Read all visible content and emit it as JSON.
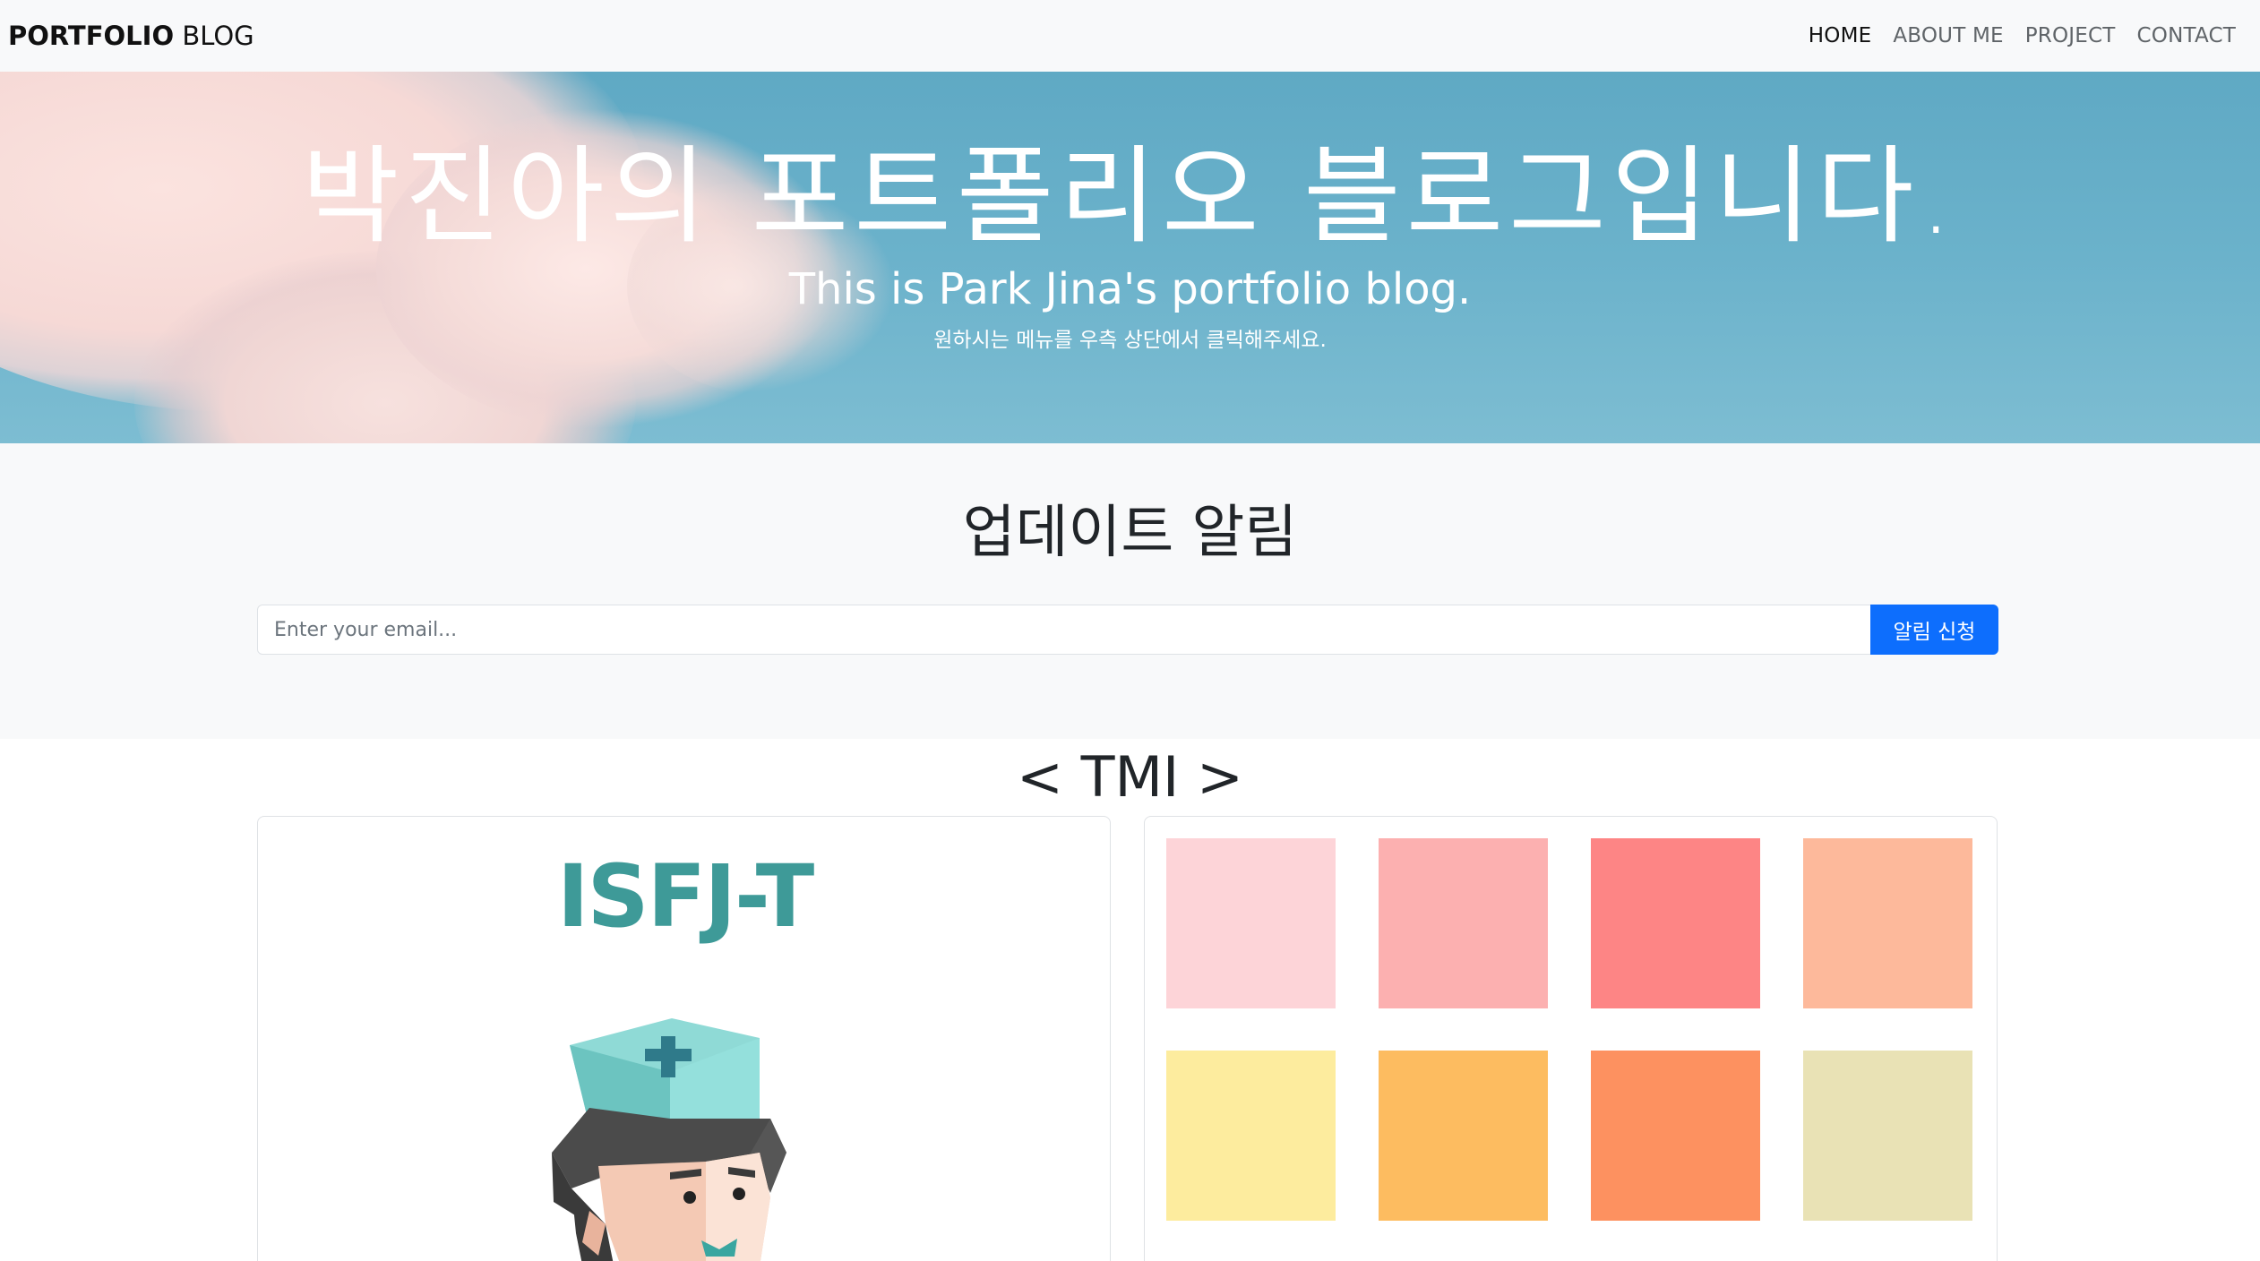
{
  "navbar": {
    "brand_bold": "PORTFOLIO",
    "brand_light": "BLOG",
    "links": [
      {
        "label": "HOME",
        "active": true
      },
      {
        "label": "ABOUT ME",
        "active": false
      },
      {
        "label": "PROJECT",
        "active": false
      },
      {
        "label": "CONTACT",
        "active": false
      }
    ]
  },
  "hero": {
    "title": "박진아의 포트폴리오 블로그입니다.",
    "subtitle": "This is Park Jina's portfolio blog.",
    "hint": "원하시는 메뉴를 우측 상단에서 클릭해주세요."
  },
  "subscribe": {
    "title": "업데이트 알림",
    "email_placeholder": "Enter your email...",
    "button_label": "알림 신청",
    "button_color": "#0d6efd"
  },
  "tmi": {
    "title": "< TMI >",
    "mbti_card": {
      "mbti": "ISFJ-T",
      "text_color": "#3e9a98",
      "image_icon": "nurse-avatar-icon"
    },
    "palette_card": {
      "swatches": [
        [
          "#fdd4d8",
          "#fcb0b0",
          "#fd8585",
          "#fdb99b"
        ],
        [
          "#fdec9e",
          "#fdbc60",
          "#fd9160",
          "#e9e2b5"
        ]
      ]
    }
  }
}
